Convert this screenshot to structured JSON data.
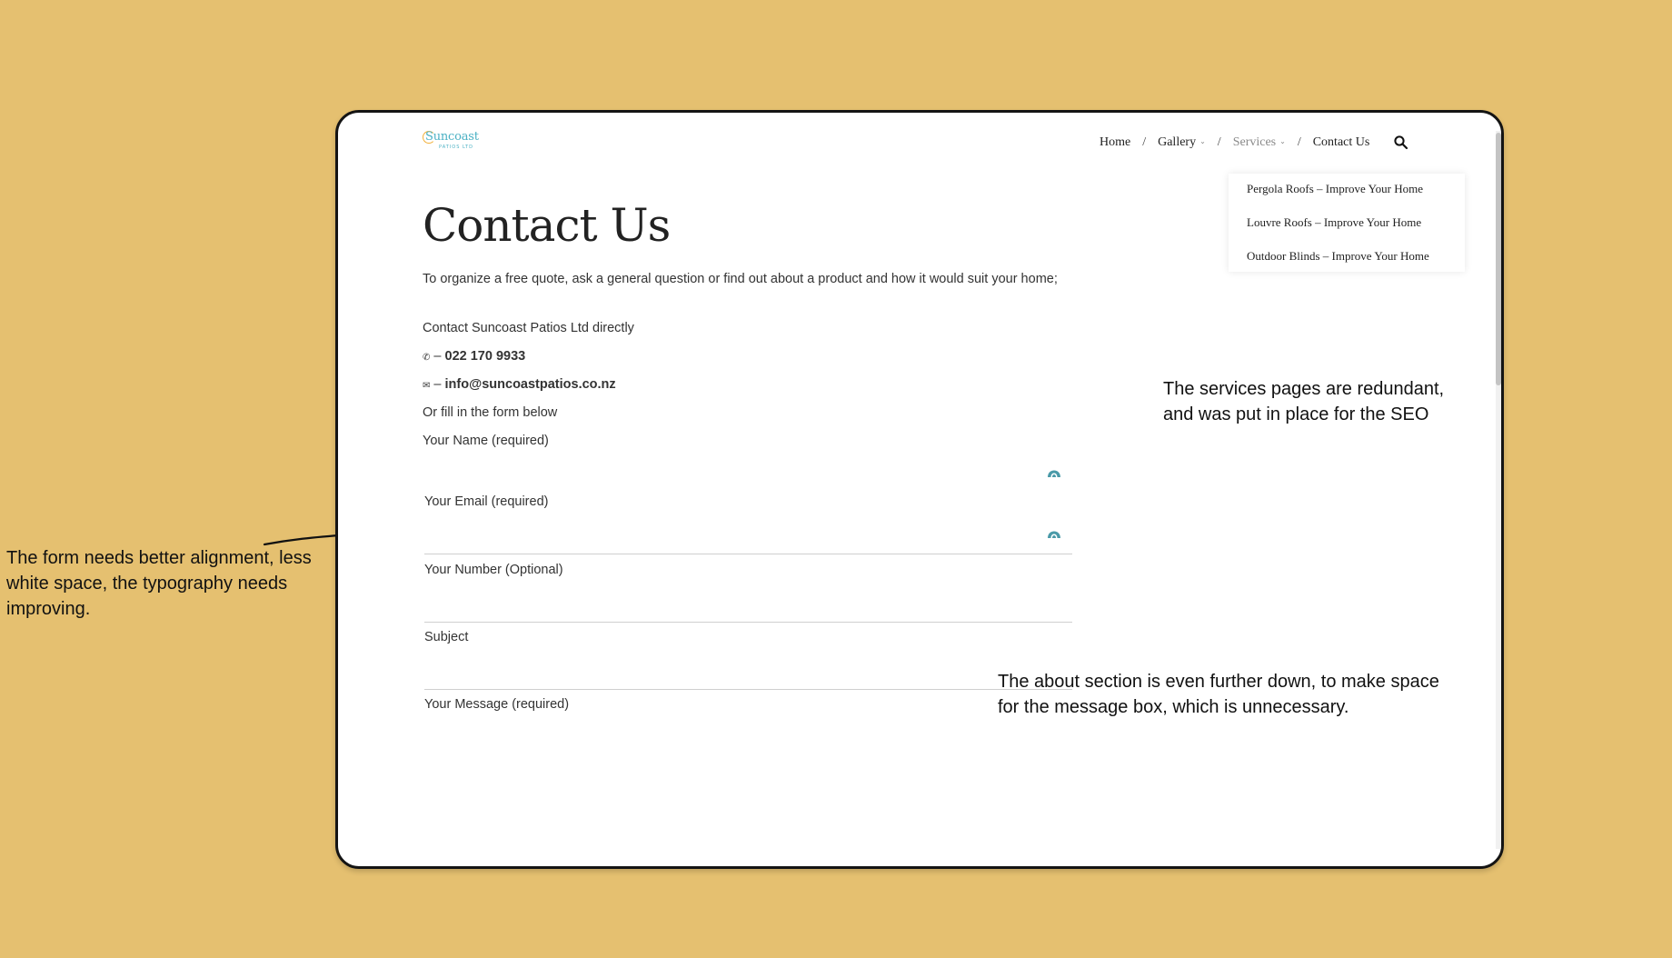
{
  "logo": {
    "brand": "Suncoast",
    "sub": "PATIOS LTD"
  },
  "nav": {
    "items": [
      {
        "label": "Home",
        "chevron": false,
        "dim": false
      },
      {
        "label": "Gallery",
        "chevron": true,
        "dim": false
      },
      {
        "label": "Services",
        "chevron": true,
        "dim": true
      },
      {
        "label": "Contact Us",
        "chevron": false,
        "dim": false
      }
    ],
    "separator": "/",
    "chevron_glyph": "⌄",
    "search_icon": "search-icon"
  },
  "dropdown": {
    "items": [
      "Pergola Roofs – Improve Your Home",
      "Louvre Roofs – Improve Your Home",
      "Outdoor Blinds – Improve Your Home"
    ]
  },
  "page": {
    "title": "Contact Us",
    "intro": "To organize a free quote, ask a general question or find out about a product and how it would suit your home;",
    "contact_line": "Contact Suncoast Patios Ltd directly",
    "phone_glyph": "✆",
    "phone_dash": " – ",
    "phone": "022 170 9933",
    "email_glyph": "✉",
    "email_dash": " – ",
    "email": "info@suncoastpatios.co.nz",
    "form_intro": "Or fill in the form below"
  },
  "form": {
    "name_label": "Your Name (required)",
    "email_label": "Your Email (required)",
    "number_label": "Your Number (Optional)",
    "subject_label": "Subject",
    "message_label": "Your Message (required)"
  },
  "annotations": {
    "services": "The services pages are redundant, and was put in place for the SEO",
    "form": "The form needs better alignment,  less white space, the typography needs improving.",
    "about": "The about section is even further down, to make space for the message box, which is unnecessary."
  },
  "colors": {
    "background": "#e5c070",
    "brand": "#4bb1c4",
    "autofill_icon": "#4a9aa8"
  }
}
